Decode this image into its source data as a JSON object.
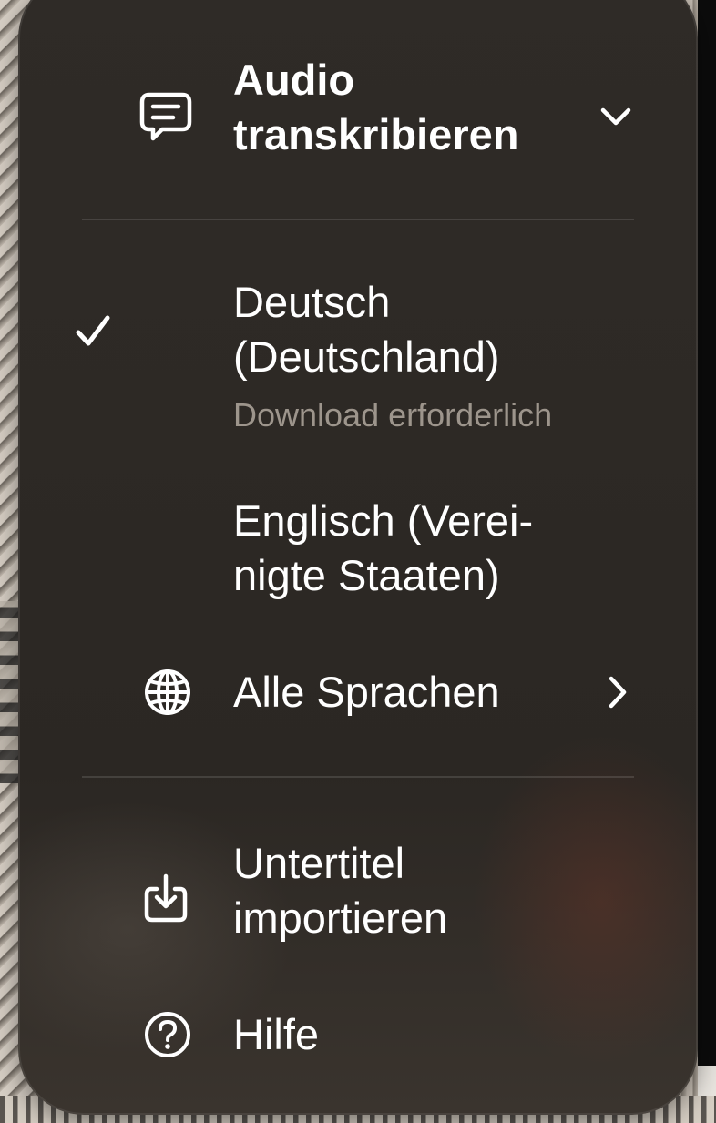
{
  "menu": {
    "header": {
      "title": "Audio\ntranskribieren",
      "icon": "speech-bubble-icon",
      "expand_icon": "chevron-down-icon"
    },
    "languages": [
      {
        "label": "Deutsch\n(Deutschland)",
        "sublabel": "Download erforderlich",
        "selected": true
      },
      {
        "label": "Englisch (Verei-\nnigte Staaten)",
        "selected": false
      }
    ],
    "all_languages": {
      "label": "Alle Sprachen",
      "icon": "globe-icon",
      "chevron": "chevron-right-icon"
    },
    "import_subtitles": {
      "label": "Untertitel\nimportieren",
      "icon": "import-download-icon"
    },
    "help": {
      "label": "Hilfe",
      "icon": "question-circle-icon"
    }
  },
  "colors": {
    "menu_background": "#2d2925",
    "text": "#ffffff",
    "secondary_text": "#9d958c",
    "divider": "rgba(255,255,255,0.12)"
  }
}
